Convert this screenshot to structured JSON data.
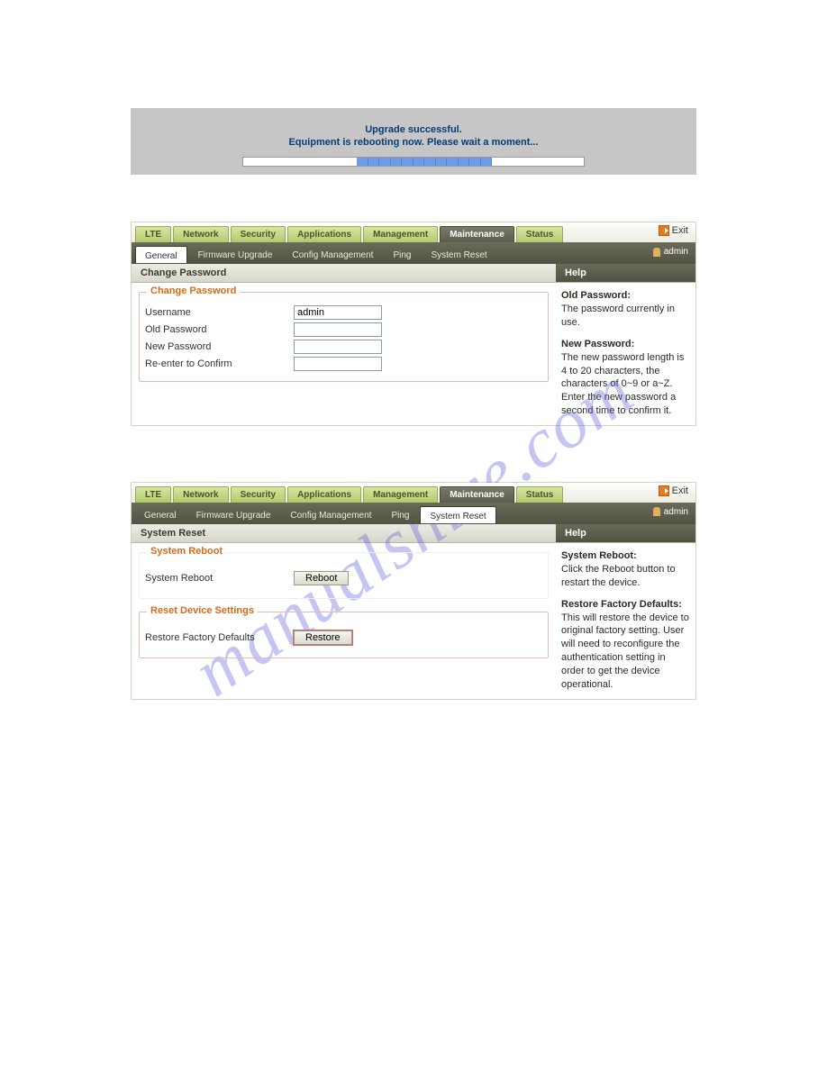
{
  "watermark": "manualshive.com",
  "upgrade": {
    "line1": "Upgrade successful.",
    "line2": "Equipment is rebooting now. Please wait a moment..."
  },
  "main_tabs": [
    "LTE",
    "Network",
    "Security",
    "Applications",
    "Management",
    "Maintenance",
    "Status"
  ],
  "exit_label": "Exit",
  "admin_label": "admin",
  "panel1": {
    "active_main_index": 5,
    "active_main_style": "dark",
    "sub_tabs": [
      "General",
      "Firmware Upgrade",
      "Config Management",
      "Ping",
      "System Reset"
    ],
    "active_sub_index": 0,
    "main_header": "Change Password",
    "group_legend": "Change Password",
    "form": {
      "username_label": "Username",
      "username_value": "admin",
      "oldpw_label": "Old Password",
      "newpw_label": "New Password",
      "confirm_label": "Re-enter to Confirm"
    },
    "help": {
      "header": "Help",
      "old_title": "Old Password:",
      "old_text": "The password currently in use.",
      "new_title": "New Password:",
      "new_text": "The new password length is 4 to 20 characters, the characters of 0~9 or a~Z.  Enter the new password a second time to confirm it."
    }
  },
  "panel2": {
    "active_main_index": 5,
    "sub_tabs": [
      "General",
      "Firmware Upgrade",
      "Config Management",
      "Ping",
      "System Reset"
    ],
    "active_sub_index": 4,
    "main_header": "System Reset",
    "group1_legend": "System Reboot",
    "reboot_row_label": "System Reboot",
    "reboot_btn": "Reboot",
    "group2_legend": "Reset Device Settings",
    "restore_row_label": "Restore Factory Defaults",
    "restore_btn": "Restore",
    "help": {
      "header": "Help",
      "t1": "System Reboot:",
      "p1": "Click the Reboot button to restart the device.",
      "t2": "Restore Factory Defaults:",
      "p2": "This will restore the device to original factory setting. User will need to reconfigure the authentication setting in order to get the device operational."
    }
  }
}
